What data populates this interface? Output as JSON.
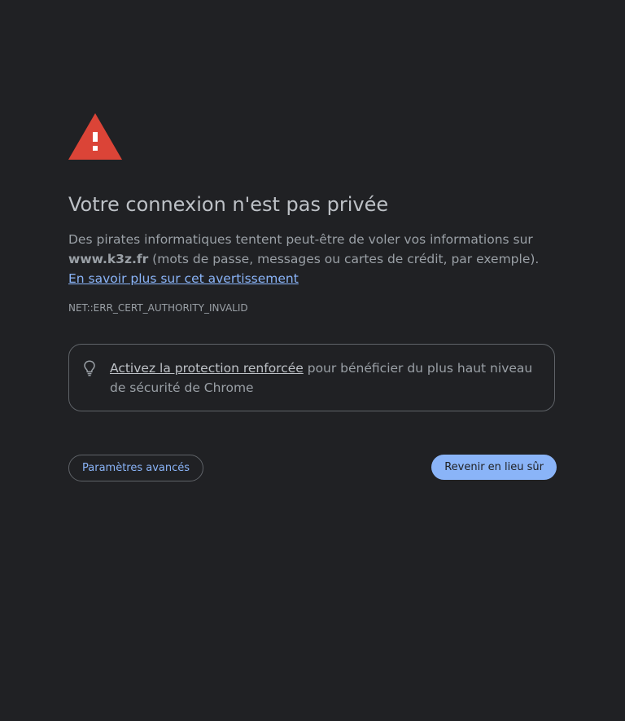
{
  "page": {
    "background": "#202124",
    "accent": "#8ab4f8",
    "warning_color": "#db4437"
  },
  "icons": {
    "warning": "warning-triangle-icon",
    "bulb": "lightbulb-icon"
  },
  "heading": "Votre connexion n'est pas privée",
  "explanation": {
    "text_before": "Des pirates informatiques tentent peut-être de voler vos informations sur ",
    "domain": "www.k3z.fr",
    "text_after": " (mots de passe, messages ou cartes de crédit, par exemple). ",
    "learn_more_link": "En savoir plus sur cet avertissement"
  },
  "error_code": "NET::ERR_CERT_AUTHORITY_INVALID",
  "enhanced_protection": {
    "link": "Activez la protection renforcée",
    "text": " pour bénéficier du plus haut niveau de sécurité de Chrome"
  },
  "buttons": {
    "advanced": "Paramètres avancés",
    "back_to_safety": "Revenir en lieu sûr"
  }
}
